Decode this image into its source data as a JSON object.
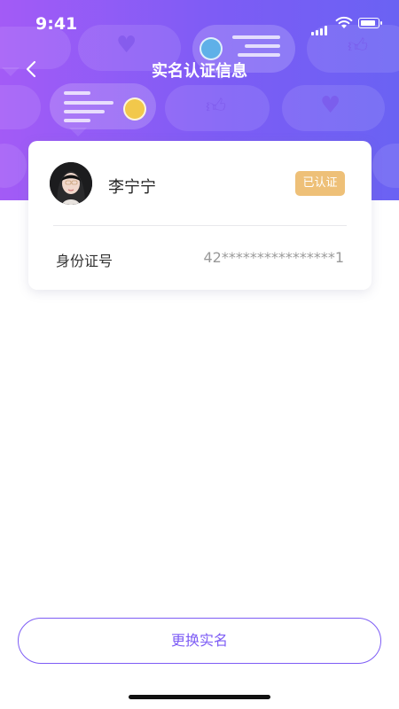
{
  "status_bar": {
    "time": "9:41"
  },
  "header": {
    "title": "实名认证信息"
  },
  "profile": {
    "name": "李宁宁",
    "verified_badge": "已认证",
    "id_label": "身份证号",
    "id_value": "42****************1"
  },
  "actions": {
    "change_name_button": "更换实名"
  },
  "colors": {
    "gradient_start": "#a35bf6",
    "gradient_end": "#6a62f3",
    "accent": "#7d5cf5",
    "badge": "#eec078"
  },
  "icons": {
    "back": "chevron-left-icon",
    "signal": "cellular-signal-icon",
    "wifi": "wifi-icon",
    "battery": "battery-icon"
  }
}
